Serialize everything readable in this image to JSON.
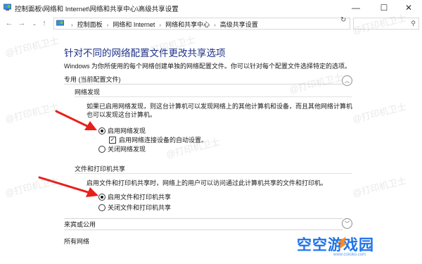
{
  "window": {
    "title": "控制面板\\网络和 Internet\\网络和共享中心\\高级共享设置",
    "controls": {
      "minimize": "—",
      "maximize": "☐",
      "close": "✕"
    }
  },
  "address_bar": {
    "breadcrumbs": [
      "控制面板",
      "网络和 Internet",
      "网络和共享中心",
      "高级共享设置"
    ]
  },
  "page": {
    "title": "针对不同的网络配置文件更改共享选项",
    "description": "Windows 为你所使用的每个网络创建单独的网络配置文件。你可以针对每个配置文件选择特定的选项。"
  },
  "private_profile": {
    "header": "专用 (当前配置文件)",
    "network_discovery": {
      "header": "网络发现",
      "description": "如果已启用网络发现，则这台计算机可以发现网络上的其他计算机和设备，而且其他网络计算机也可以发现这台计算机。",
      "options": [
        "启用网络发现",
        "关闭网络发现"
      ],
      "selected": 0,
      "auto_setup_label": "启用网络连接设备的自动设置。",
      "auto_setup_checked": true
    },
    "file_printer_sharing": {
      "header": "文件和打印机共享",
      "description": "启用文件和打印机共享时，网络上的用户可以访问通过此计算机共享的文件和打印机。",
      "options": [
        "启用文件和打印机共享",
        "关闭文件和打印机共享"
      ],
      "selected": 0
    }
  },
  "guest_profile": {
    "header": "来宾或公用"
  },
  "all_networks": {
    "header": "所有网络"
  },
  "watermark": {
    "text": "@打印机卫士"
  },
  "brand": {
    "name": "空空游戏园",
    "url": "www.cckoko.com"
  },
  "colors": {
    "title_blue": "#1e3287",
    "arrow_red": "#e8201c",
    "brand_blue": "#1e73e8"
  }
}
